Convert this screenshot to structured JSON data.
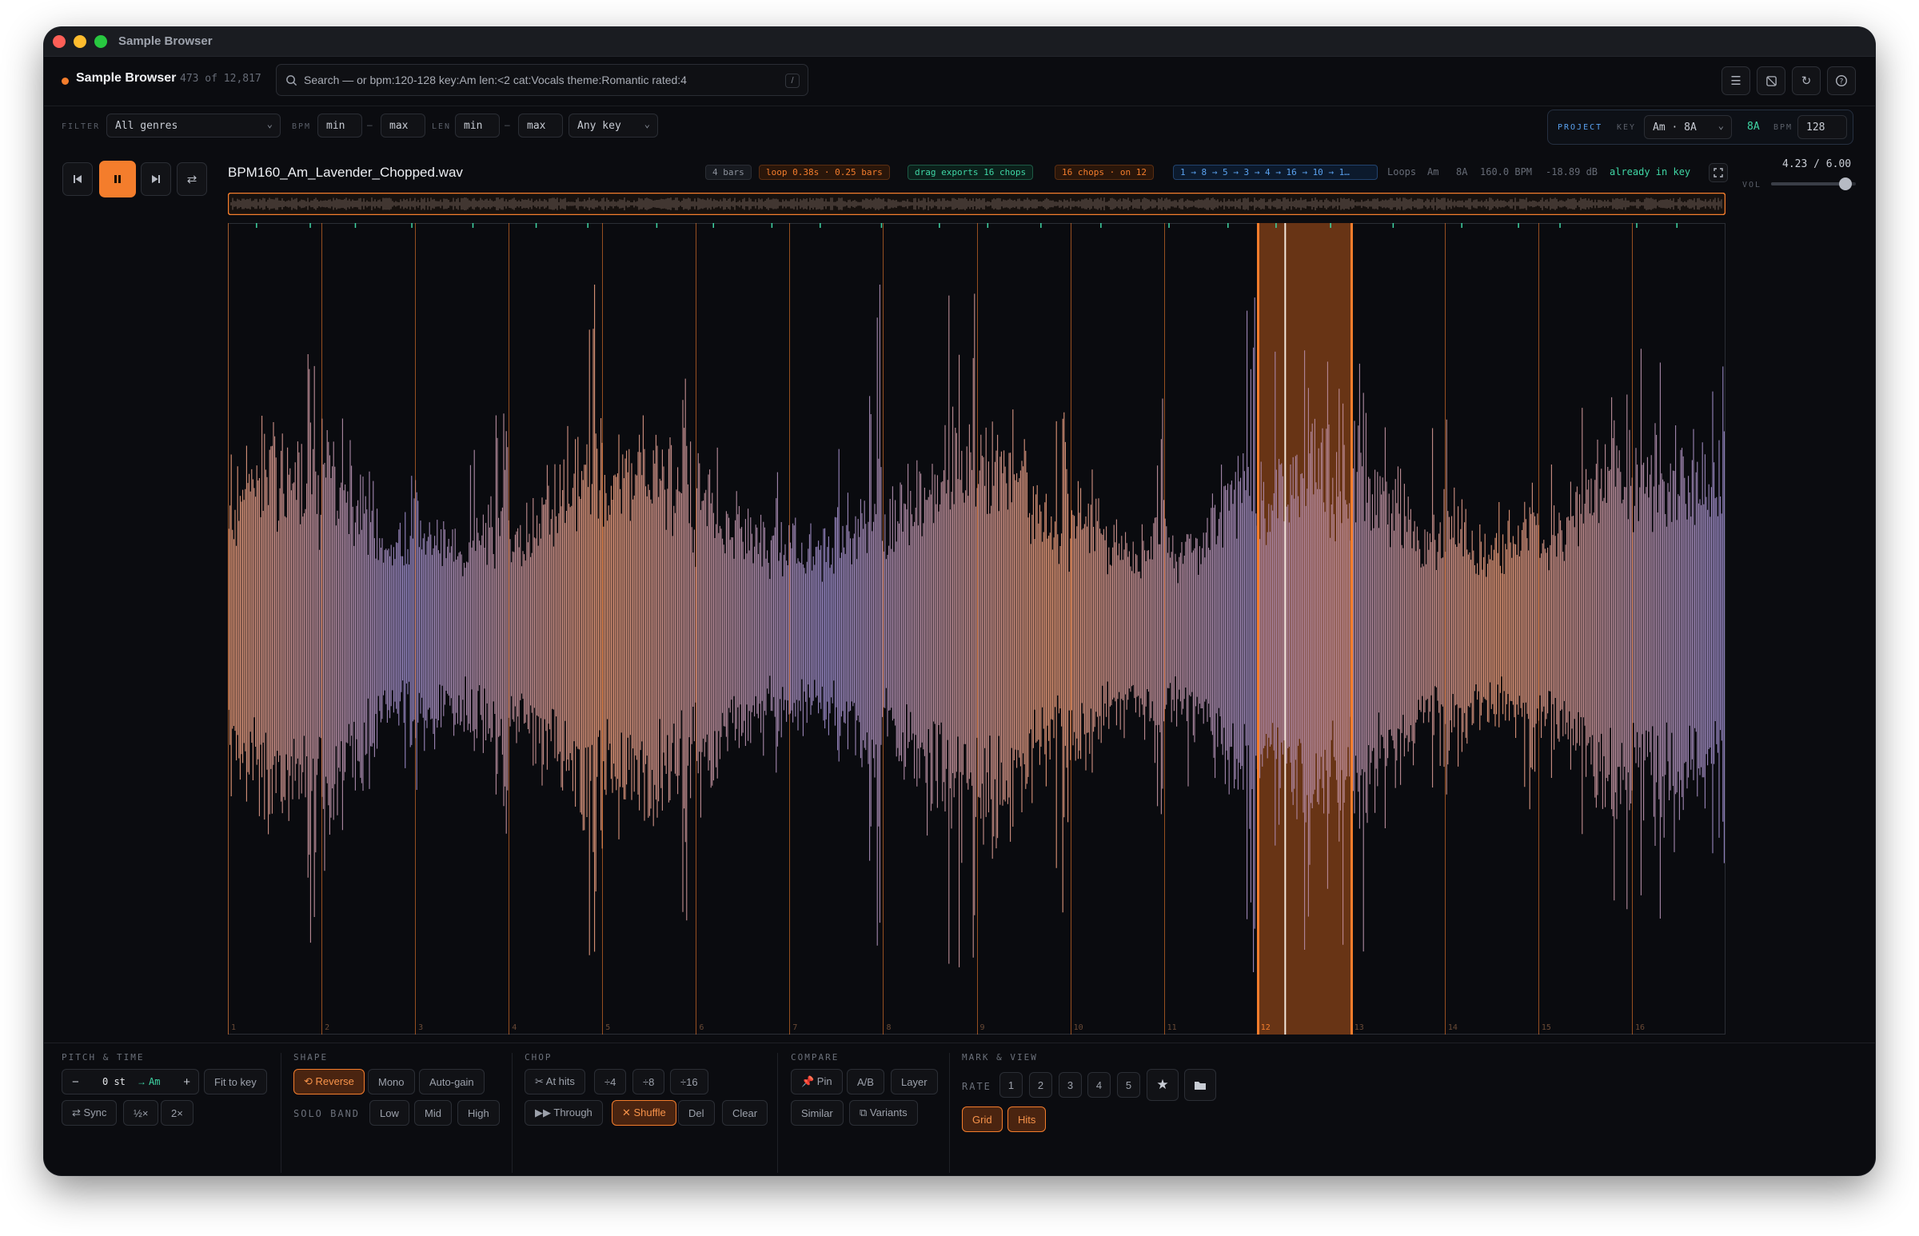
{
  "window": {
    "title": "Sample Browser"
  },
  "header": {
    "app_name": "Sample Browser",
    "count": "473 of 12,817",
    "search_placeholder": "Search — or bpm:120-128  key:Am  len:<2  cat:Vocals  theme:Romantic  rated:4",
    "search_shortcut": "/"
  },
  "filter": {
    "label": "FILTER",
    "genre": "All genres",
    "bpm_label": "BPM",
    "bpm_min": "min",
    "bpm_max": "max",
    "len_label": "LEN",
    "len_min": "min",
    "len_max": "max",
    "key": "Any key",
    "dash": "–"
  },
  "project": {
    "label": "PROJECT",
    "key_label": "KEY",
    "key_value": "Am · 8A",
    "camelot": "8A",
    "bpm_label": "BPM",
    "bpm_value": "128"
  },
  "player": {
    "filename": "BPM160_Am_Lavender_Chopped.wav",
    "chips": {
      "bars": "4 bars",
      "loop": "loop 0.38s · 0.25 bars",
      "drag": "drag exports 16 chops",
      "chops": "16 chops · on 12",
      "order": "1 → 8 → 5 → 3 → 4 → 16 → 10 → 1…"
    },
    "meta": {
      "category": "Loops",
      "key": "Am",
      "camelot": "8A",
      "bpm": "160.0 BPM",
      "db": "-18.89 dB",
      "status": "already in key"
    },
    "time": "4.23 / 6.00",
    "vol_label": "VOL",
    "volume": 0.88,
    "playhead": 0.706,
    "chop_labels": [
      "1",
      "2",
      "3",
      "4",
      "5",
      "6",
      "7",
      "8",
      "9",
      "10",
      "11",
      "12",
      "13",
      "14",
      "15",
      "16"
    ],
    "selected_chop": 12
  },
  "bottom": {
    "pitch_time": {
      "title": "PITCH & TIME",
      "minus": "−",
      "semitones": "0 st",
      "arrow": "→",
      "key": "Am",
      "plus": "+",
      "fit": "Fit to key",
      "sync": "⇄ Sync",
      "half": "½×",
      "double": "2×"
    },
    "shape": {
      "title": "SHAPE",
      "reverse": "⟲ Reverse",
      "mono": "Mono",
      "autogain": "Auto-gain",
      "solo_band": "SOLO BAND",
      "low": "Low",
      "mid": "Mid",
      "high": "High"
    },
    "chop": {
      "title": "CHOP",
      "at_hits": "✂ At hits",
      "div4": "÷4",
      "div8": "÷8",
      "div16": "÷16",
      "through": "▶▶ Through",
      "shuffle": "✕ Shuffle",
      "del": "Del",
      "clear": "Clear"
    },
    "compare": {
      "title": "COMPARE",
      "pin": "📌 Pin",
      "ab": "A/B",
      "layer": "Layer",
      "similar": "Similar",
      "variants": "⧉ Variants"
    },
    "mark_view": {
      "title": "MARK & VIEW",
      "rate": "RATE",
      "r1": "1",
      "r2": "2",
      "r3": "3",
      "r4": "4",
      "r5": "5",
      "grid": "Grid",
      "hits": "Hits"
    }
  },
  "colors": {
    "accent": "#f47d2c",
    "wave_a": "#f1a07c",
    "wave_b": "#9f8fcf",
    "teal": "#3fd6a5",
    "blue": "#5aa2f0"
  },
  "icons": [
    "prev-icon",
    "pause-icon",
    "next-icon",
    "loop-icon",
    "list-icon",
    "image-icon",
    "refresh-icon",
    "help-icon",
    "search-icon",
    "expand-icon",
    "star-icon",
    "folder-icon"
  ]
}
